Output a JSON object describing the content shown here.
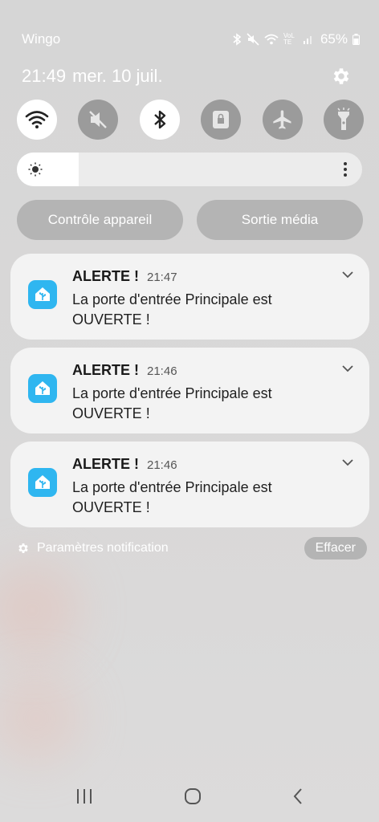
{
  "status_bar": {
    "carrier": "Wingo",
    "signal_label": "VoLTE",
    "battery": "65%"
  },
  "header": {
    "time": "21:49",
    "date": "mer. 10 juil."
  },
  "quick_settings": [
    {
      "icon": "wifi-icon",
      "state": "on"
    },
    {
      "icon": "mute-icon",
      "state": "off"
    },
    {
      "icon": "bluetooth-icon",
      "state": "on"
    },
    {
      "icon": "lock-icon",
      "state": "off"
    },
    {
      "icon": "airplane-icon",
      "state": "off"
    },
    {
      "icon": "flashlight-icon",
      "state": "off"
    }
  ],
  "brightness": {
    "level": 0.18
  },
  "pills": {
    "device_control": "Contrôle appareil",
    "media_output": "Sortie média"
  },
  "notifications": [
    {
      "title": "ALERTE !",
      "time": "21:47",
      "body": "La porte d'entrée Principale est OUVERTE !",
      "icon": "home-assistant-icon"
    },
    {
      "title": "ALERTE !",
      "time": "21:46",
      "body": "La porte d'entrée Principale est OUVERTE !",
      "icon": "home-assistant-icon"
    },
    {
      "title": "ALERTE !",
      "time": "21:46",
      "body": "La porte d'entrée Principale est OUVERTE !",
      "icon": "home-assistant-icon"
    }
  ],
  "footer": {
    "settings_label": "Paramètres notification",
    "clear_label": "Effacer"
  },
  "colors": {
    "accent": "#2fb6f0",
    "panel": "#f3f3f3",
    "pill": "#b4b4b4"
  }
}
